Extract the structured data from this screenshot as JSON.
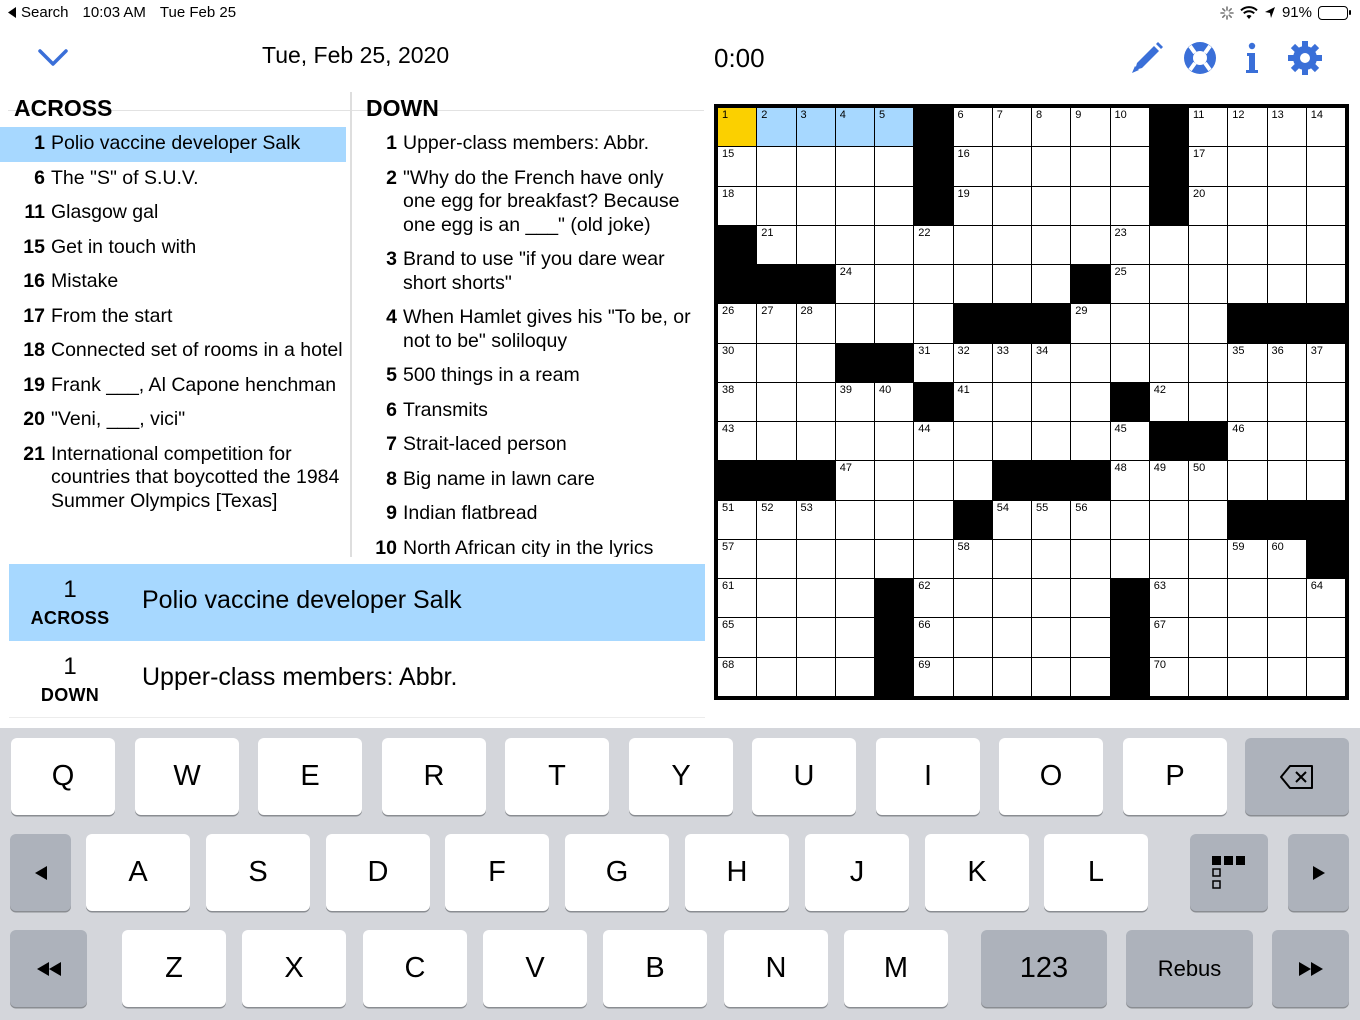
{
  "status": {
    "back_label": "Search",
    "time": "10:03 AM",
    "date": "Tue Feb 25",
    "battery": "91%",
    "battery_fraction": 0.91
  },
  "header": {
    "title": "Tue, Feb 25, 2020",
    "timer": "0:00"
  },
  "icons": {
    "collapse": "chevron-down-icon",
    "pencil": "pencil-icon",
    "help": "lifebuoy-icon",
    "info": "info-icon",
    "settings": "gear-icon"
  },
  "colors": {
    "accent": "#3a6fd8",
    "highlight": "#a7d8ff",
    "cursor": "#fbd000"
  },
  "across": {
    "heading": "ACROSS",
    "clues": [
      {
        "num": "1",
        "text": "Polio vaccine developer Salk"
      },
      {
        "num": "6",
        "text": "The \"S\" of S.U.V."
      },
      {
        "num": "11",
        "text": "Glasgow gal"
      },
      {
        "num": "15",
        "text": "Get in touch with"
      },
      {
        "num": "16",
        "text": "Mistake"
      },
      {
        "num": "17",
        "text": "From the start"
      },
      {
        "num": "18",
        "text": "Connected set of rooms in a hotel"
      },
      {
        "num": "19",
        "text": "Frank ___, Al Capone henchman"
      },
      {
        "num": "20",
        "text": "\"Veni, ___, vici\""
      },
      {
        "num": "21",
        "text": "International competition for countries that boycotted the 1984 Summer Olympics [Texas]"
      }
    ]
  },
  "down": {
    "heading": "DOWN",
    "clues": [
      {
        "num": "1",
        "text": "Upper-class members: Abbr."
      },
      {
        "num": "2",
        "text": "\"Why do the French have only one egg for breakfast? Because one egg is an ___\" (old joke)"
      },
      {
        "num": "3",
        "text": "Brand to use \"if you dare wear short shorts\""
      },
      {
        "num": "4",
        "text": "When Hamlet gives his \"To be, or not to be\" soliloquy"
      },
      {
        "num": "5",
        "text": "500 things in a ream"
      },
      {
        "num": "6",
        "text": "Transmits"
      },
      {
        "num": "7",
        "text": "Strait-laced person"
      },
      {
        "num": "8",
        "text": "Big name in lawn care"
      },
      {
        "num": "9",
        "text": "Indian flatbread"
      },
      {
        "num": "10",
        "text": "North African city in the lyrics"
      }
    ]
  },
  "current": {
    "across": {
      "num": "1",
      "dir": "ACROSS",
      "text": "Polio vaccine developer Salk"
    },
    "down": {
      "num": "1",
      "dir": "DOWN",
      "text": "Upper-class members: Abbr."
    }
  },
  "grid": {
    "size": 15,
    "rows": [
      ".....#.....#...",
      ".....#.....#...",
      ".....#.....#...",
      "#.....#........",
      "###.......#....",
      "......###......",
      "....##.........",
      "......#.....#..",
      "...........##..",
      "###.....###....",
      "......#........",
      "...............",
      "....#.....#....",
      "....#.....#....",
      "....#.....#...."
    ],
    "blacks_extra": [
      [
        9,
        3,
        "#"
      ],
      [
        10,
        11,
        "#"
      ],
      [
        10,
        12,
        "#"
      ],
      [
        10,
        13,
        "#"
      ],
      [
        11,
        14,
        "#"
      ]
    ],
    "numbers": [
      [
        0,
        0,
        1
      ],
      [
        0,
        1,
        2
      ],
      [
        0,
        2,
        3
      ],
      [
        0,
        3,
        4
      ],
      [
        0,
        4,
        5
      ],
      [
        0,
        6,
        6
      ],
      [
        0,
        7,
        7
      ],
      [
        0,
        8,
        8
      ],
      [
        0,
        9,
        9
      ],
      [
        0,
        10,
        10
      ],
      [
        0,
        12,
        11
      ],
      [
        0,
        13,
        12
      ],
      [
        0,
        14,
        13
      ],
      [
        0,
        15,
        14
      ],
      [
        1,
        0,
        15
      ],
      [
        1,
        6,
        16
      ],
      [
        1,
        12,
        17
      ],
      [
        2,
        0,
        18
      ],
      [
        2,
        6,
        19
      ],
      [
        2,
        12,
        20
      ],
      [
        3,
        1,
        21
      ],
      [
        3,
        5,
        22
      ],
      [
        3,
        10,
        23
      ],
      [
        4,
        3,
        24
      ],
      [
        4,
        10,
        25
      ],
      [
        5,
        0,
        26
      ],
      [
        5,
        1,
        27
      ],
      [
        5,
        2,
        28
      ],
      [
        5,
        9,
        29
      ],
      [
        6,
        0,
        30
      ],
      [
        6,
        5,
        31
      ],
      [
        6,
        6,
        32
      ],
      [
        6,
        7,
        33
      ],
      [
        6,
        8,
        34
      ],
      [
        6,
        13,
        35
      ],
      [
        6,
        14,
        36
      ],
      [
        6,
        15,
        37
      ],
      [
        7,
        0,
        38
      ],
      [
        7,
        3,
        39
      ],
      [
        7,
        4,
        40
      ],
      [
        7,
        6,
        41
      ],
      [
        7,
        11,
        42
      ],
      [
        8,
        0,
        43
      ],
      [
        8,
        5,
        44
      ],
      [
        8,
        10,
        45
      ],
      [
        8,
        13,
        46
      ],
      [
        9,
        3,
        47
      ],
      [
        9,
        10,
        48
      ],
      [
        9,
        11,
        49
      ],
      [
        9,
        12,
        50
      ],
      [
        10,
        0,
        51
      ],
      [
        10,
        1,
        52
      ],
      [
        10,
        2,
        53
      ],
      [
        10,
        7,
        54
      ],
      [
        10,
        8,
        55
      ],
      [
        10,
        9,
        56
      ],
      [
        11,
        0,
        57
      ],
      [
        11,
        6,
        58
      ],
      [
        11,
        13,
        59
      ],
      [
        11,
        14,
        60
      ],
      [
        12,
        0,
        61
      ],
      [
        12,
        5,
        62
      ],
      [
        12,
        11,
        63
      ],
      [
        12,
        15,
        64
      ],
      [
        13,
        0,
        65
      ],
      [
        13,
        5,
        66
      ],
      [
        13,
        11,
        67
      ],
      [
        14,
        0,
        68
      ],
      [
        14,
        5,
        69
      ],
      [
        14,
        11,
        70
      ]
    ],
    "cursor": [
      0,
      0
    ],
    "word": [
      [
        0,
        1
      ],
      [
        0,
        2
      ],
      [
        0,
        3
      ],
      [
        0,
        4
      ]
    ]
  },
  "keyboard": {
    "row1": [
      "Q",
      "W",
      "E",
      "R",
      "T",
      "Y",
      "U",
      "I",
      "O",
      "P"
    ],
    "row2": [
      "A",
      "S",
      "D",
      "F",
      "G",
      "H",
      "J",
      "K",
      "L"
    ],
    "row3": [
      "Z",
      "X",
      "C",
      "V",
      "B",
      "N",
      "M"
    ],
    "numbers_label": "123",
    "rebus_label": "Rebus"
  }
}
